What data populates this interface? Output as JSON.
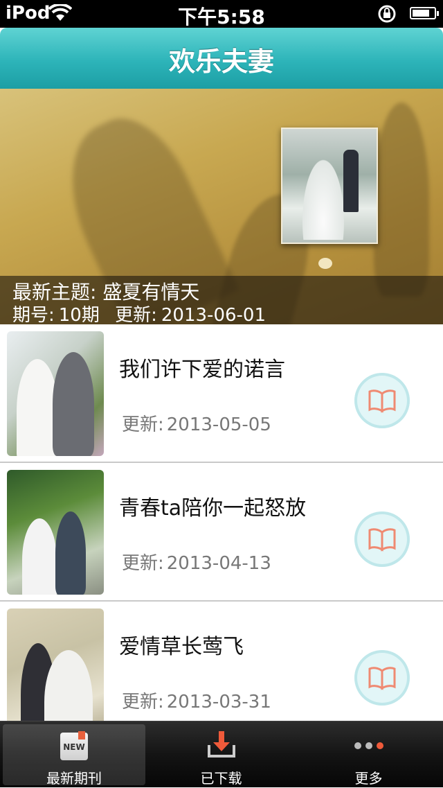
{
  "status": {
    "carrier": "iPod",
    "time": "下午5:58"
  },
  "nav": {
    "title": "欢乐夫妻"
  },
  "banner": {
    "theme_label": "最新主题:",
    "theme": "盛夏有情天",
    "issue_label": "期号:",
    "issue": "10期",
    "update_label": "更新:",
    "update": "2013-06-01"
  },
  "issues": [
    {
      "title": "我们许下爱的诺言",
      "update_label": "更新:",
      "date": "2013-05-05"
    },
    {
      "title": "青春ta陪你一起怒放",
      "update_label": "更新:",
      "date": "2013-04-13"
    },
    {
      "title": "爱情草长莺飞",
      "update_label": "更新:",
      "date": "2013-03-31"
    }
  ],
  "tabs": [
    {
      "label": "最新期刊",
      "icon": "new-badge-icon",
      "selected": true
    },
    {
      "label": "已下载",
      "icon": "download-icon",
      "selected": false
    },
    {
      "label": "更多",
      "icon": "more-dots-icon",
      "selected": false
    }
  ],
  "colors": {
    "nav": "#2db4b9",
    "accent": "#ef5a3a",
    "read_button": "#e2f6f7"
  }
}
